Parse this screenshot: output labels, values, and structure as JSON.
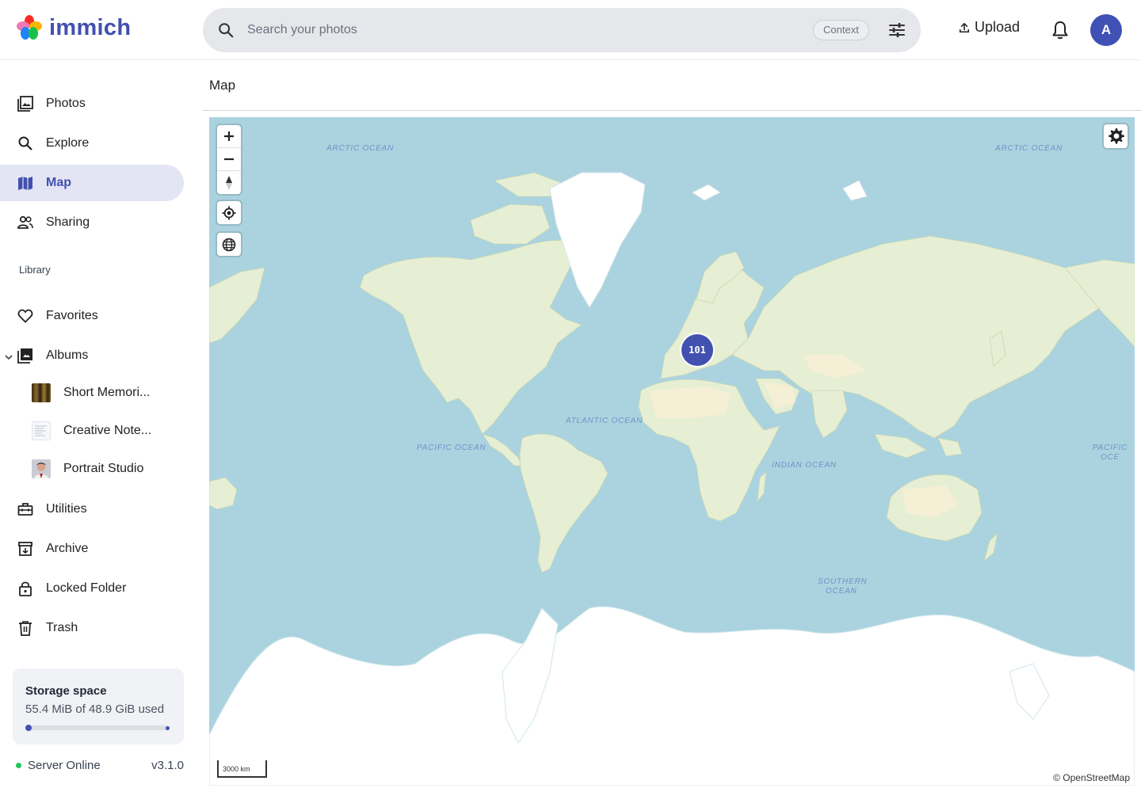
{
  "app": {
    "name": "immich"
  },
  "header": {
    "search_placeholder": "Search your photos",
    "context_label": "Context",
    "upload_label": "Upload",
    "avatar_initial": "A"
  },
  "sidebar": {
    "items": [
      {
        "label": "Photos",
        "icon": "photos-icon"
      },
      {
        "label": "Explore",
        "icon": "search-icon"
      },
      {
        "label": "Map",
        "icon": "map-icon",
        "active": true
      },
      {
        "label": "Sharing",
        "icon": "people-icon"
      }
    ],
    "library_label": "Library",
    "library": [
      {
        "label": "Favorites",
        "icon": "heart-icon"
      },
      {
        "label": "Albums",
        "icon": "albums-icon"
      }
    ],
    "albums": [
      {
        "label": "Short Memori..."
      },
      {
        "label": "Creative Note..."
      },
      {
        "label": "Portrait Studio"
      }
    ],
    "more": [
      {
        "label": "Utilities",
        "icon": "toolbox-icon"
      },
      {
        "label": "Archive",
        "icon": "archive-icon"
      },
      {
        "label": "Locked Folder",
        "icon": "lock-icon"
      },
      {
        "label": "Trash",
        "icon": "trash-icon"
      }
    ],
    "storage": {
      "title": "Storage space",
      "usage": "55.4 MiB of 48.9 GiB used",
      "used_fraction": 0.0011
    },
    "server": {
      "status": "Server Online",
      "version": "v3.1.0"
    }
  },
  "main": {
    "title": "Map",
    "map": {
      "ocean_labels": [
        "ARCTIC OCEAN",
        "ARCTIC OCEAN",
        "ATLANTIC OCEAN",
        "PACIFIC OCEAN",
        "INDIAN OCEAN",
        "PACIFIC OCE",
        "SOUTHERN",
        "OCEAN"
      ],
      "cluster_count": "101",
      "scale_label": "3000 km",
      "attribution": "© OpenStreetMap"
    }
  },
  "colors": {
    "accent": "#4250af",
    "ocean": "#aad3df",
    "land": "#e8f0d6",
    "ice": "#ffffff"
  }
}
